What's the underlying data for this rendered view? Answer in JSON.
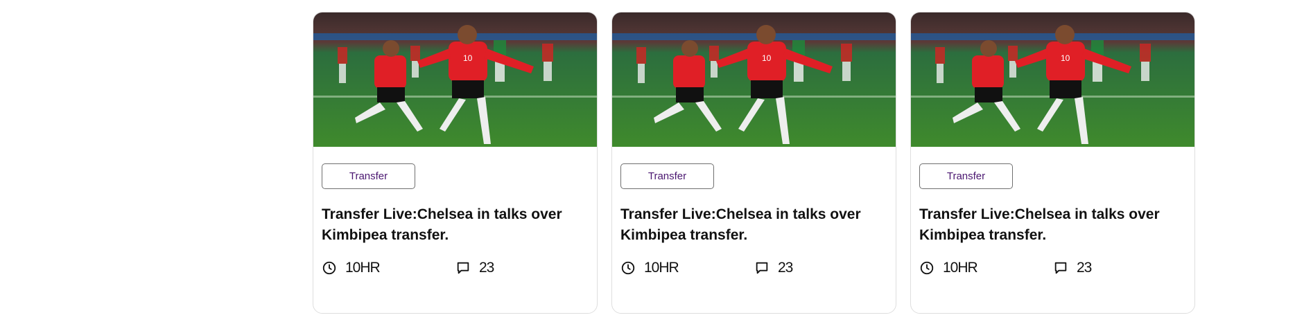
{
  "cards": [
    {
      "image": "football-celebration-photo",
      "tag": "Transfer",
      "title": "Transfer Live:Chelsea in talks over Kimbipea transfer.",
      "time_icon": "clock-icon",
      "time": "10HR",
      "comments_icon": "comment-icon",
      "comments": "23"
    },
    {
      "image": "football-celebration-photo",
      "tag": "Transfer",
      "title": "Transfer Live:Chelsea in talks over Kimbipea transfer.",
      "time_icon": "clock-icon",
      "time": "10HR",
      "comments_icon": "comment-icon",
      "comments": "23"
    },
    {
      "image": "football-celebration-photo",
      "tag": "Transfer",
      "title": "Transfer Live:Chelsea in talks over Kimbipea transfer.",
      "time_icon": "clock-icon",
      "time": "10HR",
      "comments_icon": "comment-icon",
      "comments": "23"
    }
  ],
  "colors": {
    "tag_text": "#4a1670",
    "card_border": "#dedede"
  }
}
